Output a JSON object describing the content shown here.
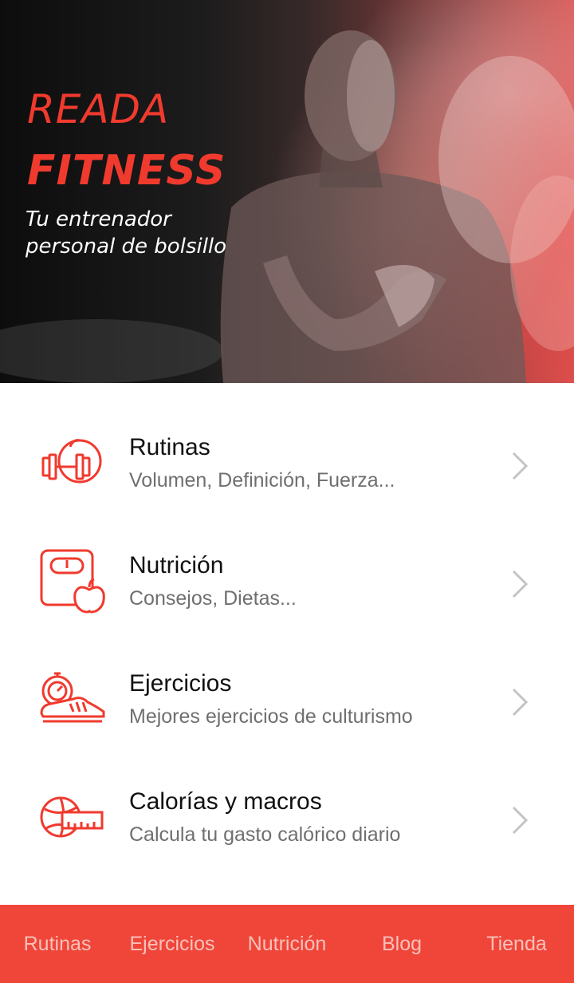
{
  "hero": {
    "brand_line1": "READA",
    "brand_line2": "FITNESS",
    "tagline": "Tu entrenador personal de bolsillo"
  },
  "menu": {
    "items": [
      {
        "title": "Rutinas",
        "subtitle": "Volumen, Definición, Fuerza...",
        "icon": "dumbbell-apple-icon"
      },
      {
        "title": "Nutrición",
        "subtitle": "Consejos, Dietas...",
        "icon": "scale-apple-icon"
      },
      {
        "title": "Ejercicios",
        "subtitle": "Mejores ejercicios de culturismo",
        "icon": "stopwatch-sneaker-icon"
      },
      {
        "title": "Calorías y macros",
        "subtitle": "Calcula tu gasto calórico diario",
        "icon": "ball-measuring-tape-icon"
      }
    ]
  },
  "bottom_nav": {
    "items": [
      "Rutinas",
      "Ejercicios",
      "Nutrición",
      "Blog",
      "Tienda"
    ]
  },
  "colors": {
    "accent": "#f03a2e",
    "nav_background": "#f0463a",
    "nav_text": "#f9c1ba",
    "title_text": "#111111",
    "subtitle_text": "#6f6f6f"
  }
}
